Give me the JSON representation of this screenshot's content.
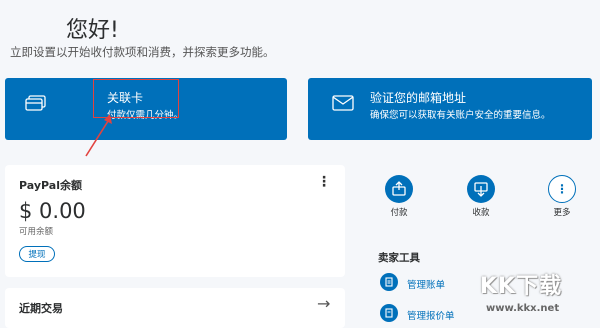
{
  "header": {
    "greeting": "您好!",
    "subtitle": "立即设置以开始收付款项和消费，并探索更多功能。"
  },
  "cards": {
    "link_card": {
      "title": "关联卡",
      "subtitle": "付款仅需几分钟。",
      "icon": "credit-card-icon"
    },
    "verify_email": {
      "title": "验证您的邮箱地址",
      "subtitle": "确保您可以获取有关账户安全的重要信息。",
      "icon": "envelope-icon"
    }
  },
  "balance": {
    "title": "PayPal余额",
    "amount": "$ 0.00",
    "available_label": "可用余额",
    "withdraw_button": "提现",
    "menu_icon": "kebab-menu-icon"
  },
  "recent": {
    "title": "近期交易",
    "arrow_icon": "arrow-right-icon"
  },
  "quick_actions": [
    {
      "label": "付款",
      "icon": "send-money-icon"
    },
    {
      "label": "收款",
      "icon": "request-money-icon"
    },
    {
      "label": "更多",
      "icon": "more-icon"
    }
  ],
  "seller_tools": {
    "title": "卖家工具",
    "items": [
      {
        "label": "管理账单",
        "icon": "invoice-icon"
      },
      {
        "label": "管理报价单",
        "icon": "estimate-icon"
      }
    ]
  },
  "watermark": {
    "text": "KK下载",
    "url": "www.kkx.net"
  },
  "colors": {
    "brand": "#0070ba",
    "highlight": "#e2433f",
    "background": "#f5f7fa"
  }
}
